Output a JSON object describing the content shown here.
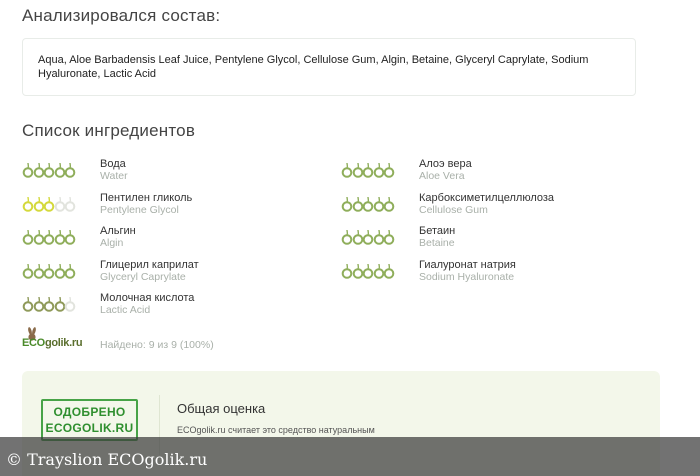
{
  "composition": {
    "title": "Анализировался состав:",
    "ingredients_text": [
      "Aqua",
      "Aloe Barbadensis Leaf Juice",
      "Pentylene Glycol",
      "Cellulose Gum",
      "Algin",
      "Betaine",
      "Glyceryl Caprylate",
      "Sodium Hyaluronate",
      "Lactic Acid"
    ]
  },
  "ingredients_list": {
    "title": "Список ингредиентов",
    "items": [
      {
        "name": "Вода",
        "latin": "Water",
        "rating": 5,
        "color": "#8fae5b"
      },
      {
        "name": "Алоэ вера",
        "latin": "Aloe Vera",
        "rating": 5,
        "color": "#8fae5b"
      },
      {
        "name": "Пентилен гликоль",
        "latin": "Pentylene Glycol",
        "rating": 3,
        "color": "#d4d93c"
      },
      {
        "name": "Карбоксиметилцеллюлоза",
        "latin": "Cellulose Gum",
        "rating": 5,
        "color": "#8fae5b"
      },
      {
        "name": "Альгин",
        "latin": "Algin",
        "rating": 5,
        "color": "#8fae5b"
      },
      {
        "name": "Бетаин",
        "latin": "Betaine",
        "rating": 5,
        "color": "#8fae5b"
      },
      {
        "name": "Глицерил каприлат",
        "latin": "Glyceryl Caprylate",
        "rating": 5,
        "color": "#8fae5b"
      },
      {
        "name": "Гиалуронат натрия",
        "latin": "Sodium Hyaluronate",
        "rating": 5,
        "color": "#8fae5b"
      },
      {
        "name": "Молочная кислота",
        "latin": "Lactic Acid",
        "rating": 4,
        "color": "#8f9a5a"
      }
    ]
  },
  "summary": {
    "logo_text_eco": "ECO",
    "logo_text_rest": "golik.ru",
    "found_text": "Найдено: 9 из 9 (100%)"
  },
  "approval": {
    "stamp_line1": "ОДОБРЕНО",
    "stamp_line2": "ECOGOLIK.RU",
    "title": "Общая оценка",
    "text": "ECOgolik.ru считает это средство натуральным"
  },
  "watermark": {
    "text": "© Trayslion ECOgolik.ru"
  },
  "colors": {
    "empty_drop": "#e2e4de",
    "stamp_green": "#47a347",
    "card_bg": "#f3f7ea"
  }
}
